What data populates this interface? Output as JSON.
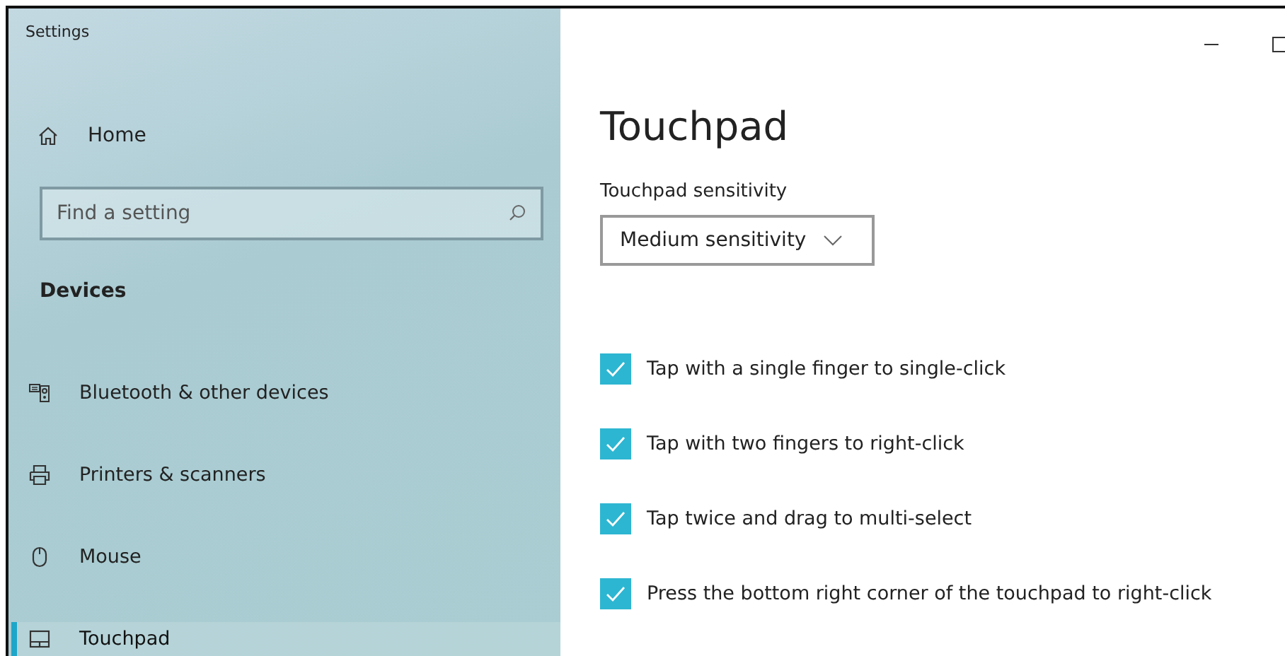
{
  "window": {
    "title": "Settings"
  },
  "sidebar": {
    "home": "Home",
    "search": {
      "placeholder": "Find a setting"
    },
    "section": "Devices",
    "items": [
      {
        "label": "Bluetooth & other devices",
        "selected": false
      },
      {
        "label": "Printers & scanners",
        "selected": false
      },
      {
        "label": "Mouse",
        "selected": false
      },
      {
        "label": "Touchpad",
        "selected": true
      }
    ]
  },
  "content": {
    "title": "Touchpad",
    "sensitivity_label": "Touchpad sensitivity",
    "sensitivity_value": "Medium sensitivity",
    "options": [
      {
        "label": "Tap with a single finger to single-click",
        "checked": true
      },
      {
        "label": "Tap with two fingers to right-click",
        "checked": true
      },
      {
        "label": "Tap twice and drag to multi-select",
        "checked": true
      },
      {
        "label": "Press the bottom right corner of the touchpad to right-click",
        "checked": true
      }
    ]
  }
}
